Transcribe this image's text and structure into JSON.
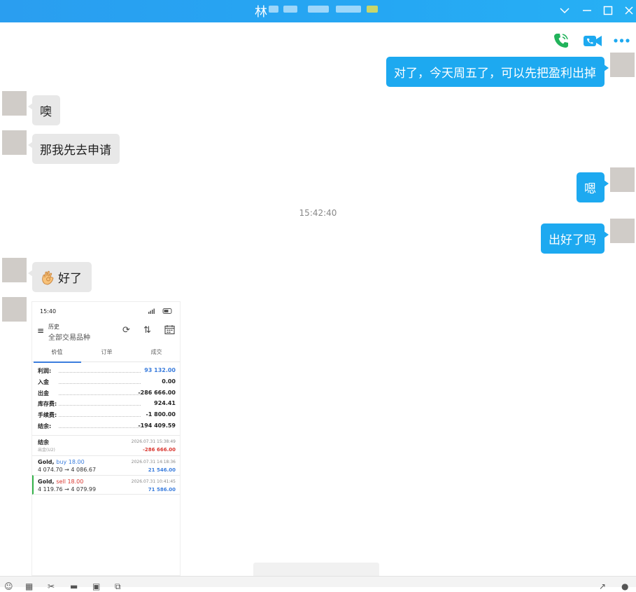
{
  "window": {
    "title": "林",
    "controls": [
      "chevron-down-icon",
      "minimize-icon",
      "maximize-icon",
      "close-icon"
    ]
  },
  "toolbar": {
    "icons": [
      "phone-icon",
      "video-call-icon",
      "more-icon"
    ],
    "colors": {
      "phone": "#22b35b",
      "video": "#1da9f0",
      "more": "#1da9f0"
    }
  },
  "messages": [
    {
      "side": "out",
      "text": "对了，今天周五了，可以先把盈利出掉"
    },
    {
      "side": "in",
      "text": "噢"
    },
    {
      "side": "in",
      "text": "那我先去申请"
    },
    {
      "side": "out",
      "text": "嗯"
    },
    {
      "side": "out",
      "text": "出好了吗"
    },
    {
      "side": "in",
      "text": "好了",
      "emoji": "ok-hand-icon"
    }
  ],
  "timestamp": "15:42:40",
  "phone_shot": {
    "status_time": "15:40",
    "header_title": "历史",
    "header_subtitle": "全部交易品种",
    "tabs": [
      "价位",
      "订单",
      "成交"
    ],
    "summary": [
      {
        "label": "利润:",
        "value": "93 132.00",
        "color": "#3b7ddd"
      },
      {
        "label": "入金",
        "value": "0.00"
      },
      {
        "label": "出金",
        "value": "-286 666.00"
      },
      {
        "label": "库存费:",
        "value": "924.41"
      },
      {
        "label": "手续费:",
        "value": "-1 800.00"
      },
      {
        "label": "结余:",
        "value": "-194 409.59"
      }
    ],
    "deals": [
      {
        "title": "结余",
        "sub": "出金(U2)",
        "time": "2026.07.31 15:38:49",
        "amount": "-286 666.00",
        "amount_color": "#d9362f"
      },
      {
        "title": "Gold,",
        "side": "buy 18.00",
        "side_color": "#3b7ddd",
        "prices": "4 074.70 → 4 086.67",
        "time": "2026.07.31 14:18:36",
        "amount": "21 546.00",
        "amount_color": "#3b7ddd"
      },
      {
        "title": "Gold,",
        "side": "sell 18.00",
        "side_color": "#d9362f",
        "prices": "4 119.76 → 4 079.99",
        "time": "2026.07.31 10:41:45",
        "amount": "71 586.00",
        "amount_color": "#3b7ddd"
      }
    ]
  }
}
